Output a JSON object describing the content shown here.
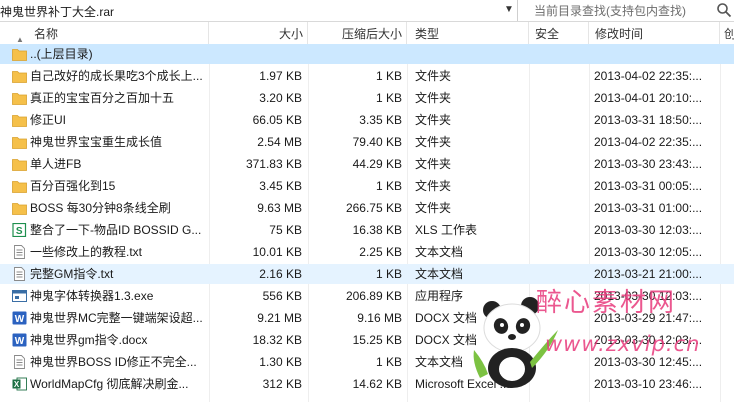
{
  "path": {
    "value": "神鬼世界补丁大全.rar"
  },
  "search": {
    "placeholder": "当前目录查找(支持包内查找)"
  },
  "columns": {
    "name": "名称",
    "size": "大小",
    "compressed": "压缩后大小",
    "type": "类型",
    "security": "安全",
    "modified": "修改时间",
    "created": "创"
  },
  "rows": [
    {
      "icon": "folder-icon",
      "name": "..(上层目录)",
      "size": "",
      "compressed": "",
      "type": "",
      "modified": ""
    },
    {
      "icon": "folder-icon",
      "name": "自己改好的成长果吃3个成长上...",
      "size": "1.97 KB",
      "compressed": "1 KB",
      "type": "文件夹",
      "modified": "2013-04-02 22:35:..."
    },
    {
      "icon": "folder-icon",
      "name": "真正的宝宝百分之百加十五",
      "size": "3.20 KB",
      "compressed": "1 KB",
      "type": "文件夹",
      "modified": "2013-04-01 20:10:..."
    },
    {
      "icon": "folder-icon",
      "name": "修正UI",
      "size": "66.05 KB",
      "compressed": "3.35 KB",
      "type": "文件夹",
      "modified": "2013-03-31 18:50:..."
    },
    {
      "icon": "folder-icon",
      "name": "神鬼世界宝宝重生成长值",
      "size": "2.54 MB",
      "compressed": "79.40 KB",
      "type": "文件夹",
      "modified": "2013-04-02 22:35:..."
    },
    {
      "icon": "folder-icon",
      "name": "单人进FB",
      "size": "371.83 KB",
      "compressed": "44.29 KB",
      "type": "文件夹",
      "modified": "2013-03-30 23:43:..."
    },
    {
      "icon": "folder-icon",
      "name": "百分百强化到15",
      "size": "3.45 KB",
      "compressed": "1 KB",
      "type": "文件夹",
      "modified": "2013-03-31 00:05:..."
    },
    {
      "icon": "folder-icon",
      "name": "BOSS 每30分钟8条线全刷",
      "size": "9.63 MB",
      "compressed": "266.75 KB",
      "type": "文件夹",
      "modified": "2013-03-31 01:00:..."
    },
    {
      "icon": "xls-icon",
      "name": "整合了一下-物品ID BOSSID G...",
      "size": "75 KB",
      "compressed": "16.38 KB",
      "type": "XLS 工作表",
      "modified": "2013-03-30 12:03:..."
    },
    {
      "icon": "text-file-icon",
      "name": "一些修改上的教程.txt",
      "size": "10.01 KB",
      "compressed": "2.25 KB",
      "type": "文本文档",
      "modified": "2013-03-30 12:05:..."
    },
    {
      "icon": "text-file-icon",
      "name": "完整GM指令.txt",
      "size": "2.16 KB",
      "compressed": "1 KB",
      "type": "文本文档",
      "modified": "2013-03-21 21:00:..."
    },
    {
      "icon": "exe-icon",
      "name": "神鬼字体转换器1.3.exe",
      "size": "556 KB",
      "compressed": "206.89 KB",
      "type": "应用程序",
      "modified": "2013-03-30 12:03:..."
    },
    {
      "icon": "word-icon",
      "name": "神鬼世界MC完整一键端架设超...",
      "size": "9.21 MB",
      "compressed": "9.16 MB",
      "type": "DOCX 文档",
      "modified": "2013-03-29 21:47:..."
    },
    {
      "icon": "word-icon",
      "name": "神鬼世界gm指令.docx",
      "size": "18.32 KB",
      "compressed": "15.25 KB",
      "type": "DOCX 文档",
      "modified": "2013-03-30 12:03:..."
    },
    {
      "icon": "text-file-icon",
      "name": "神鬼世界BOSS ID修正不完全...",
      "size": "1.30 KB",
      "compressed": "1 KB",
      "type": "文本文档",
      "modified": "2013-03-30 12:45:..."
    },
    {
      "icon": "excel-icon",
      "name": "WorldMapCfg 彻底解决刷金...",
      "size": "312 KB",
      "compressed": "14.62 KB",
      "type": "Microsoft Excel ...",
      "modified": "2013-03-10 23:46:..."
    }
  ],
  "watermark": {
    "line1": "醉心素材网",
    "line2": "www.zxvip.cn"
  },
  "colors": {
    "selected_row": "#cce8ff",
    "folder": "#f5c04a",
    "word": "#2b62c0",
    "xls": "#1e8f4e",
    "watermark": "#e83a7c"
  }
}
